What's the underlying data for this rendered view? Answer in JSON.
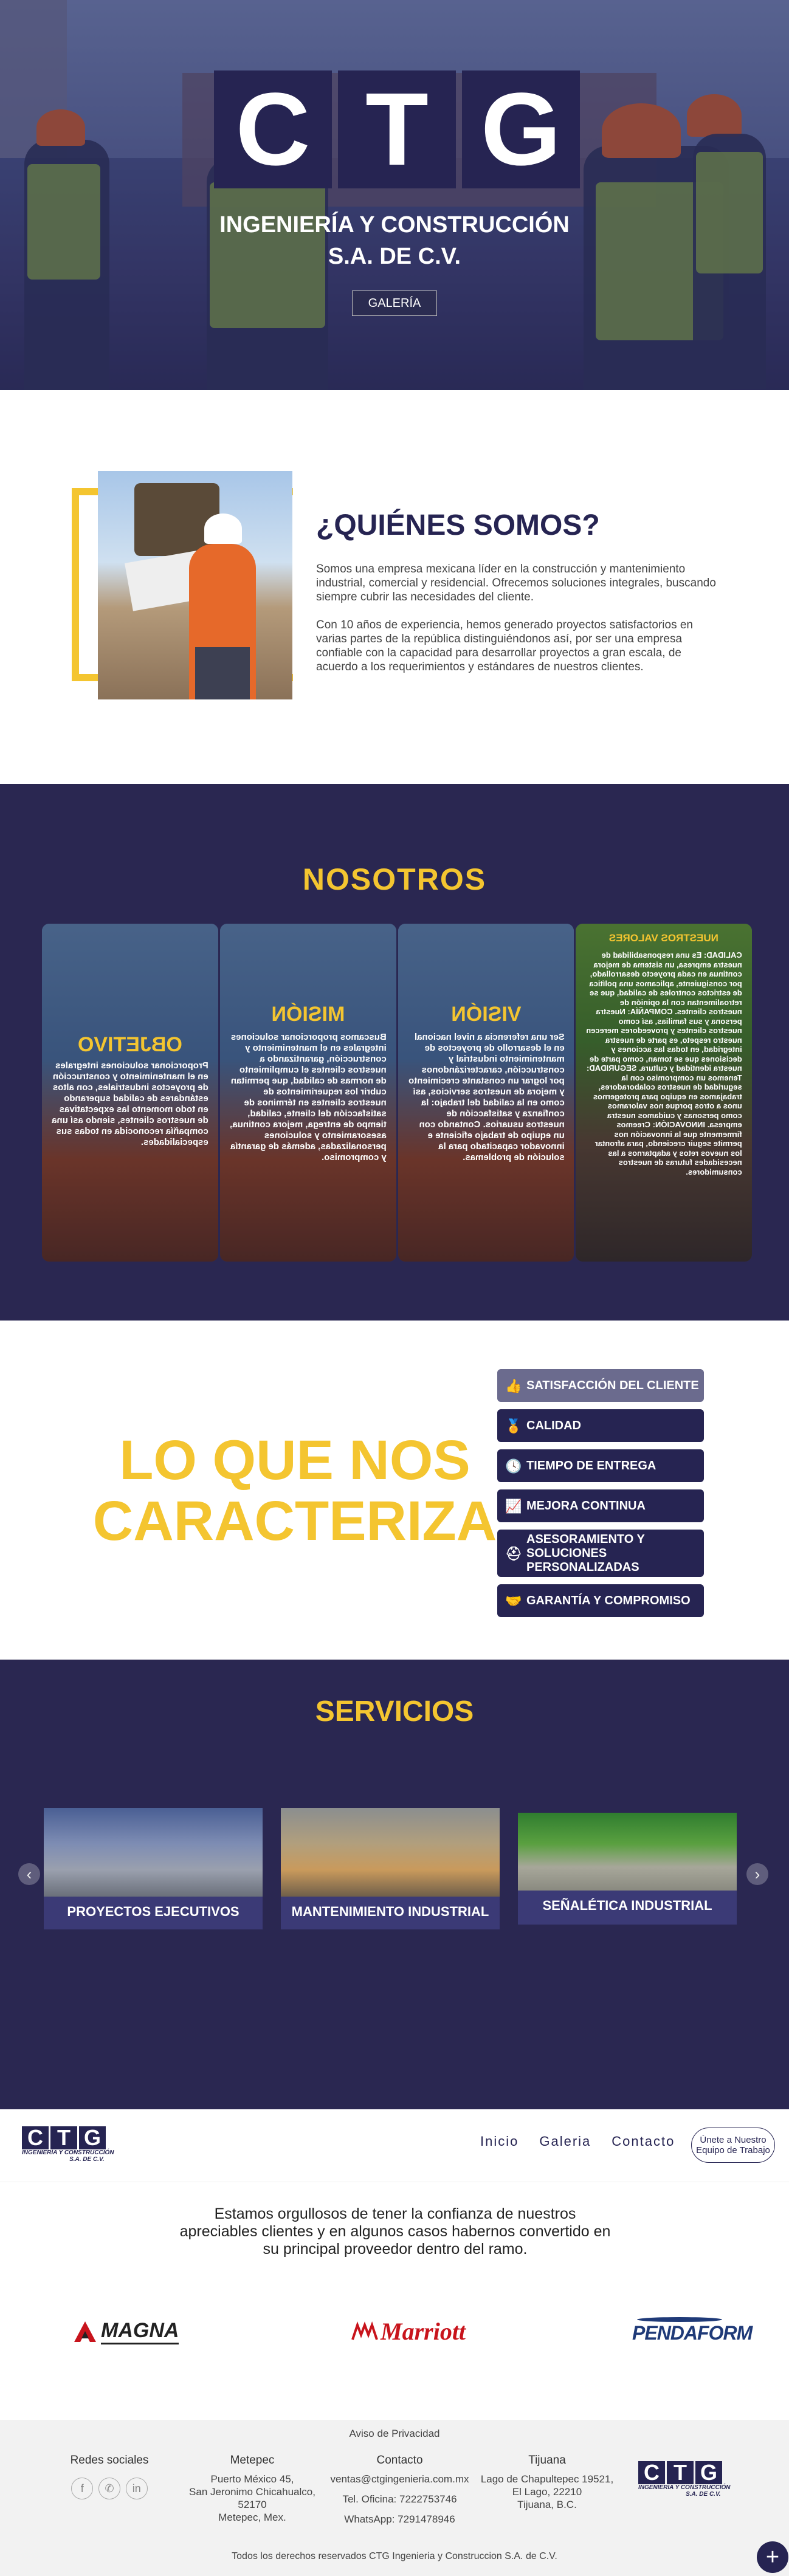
{
  "hero": {
    "logo_letters": [
      "C",
      "T",
      "G"
    ],
    "subtitle_line1": "INGENIERÍA Y CONSTRUCCIÓN",
    "subtitle_line2": "S.A. DE C.V.",
    "gallery_button": "GALERÍA"
  },
  "about": {
    "title": "¿QUIÉNES SOMOS?",
    "paragraph1": "Somos una empresa mexicana líder en la construcción y mantenimiento industrial, comercial y residencial. Ofrecemos soluciones integrales, buscando siempre cubrir las necesidades del cliente.",
    "paragraph2": "Con 10 años de experiencia, hemos generado proyectos satisfactorios en varias partes de la república distinguiéndonos así, por ser una empresa confiable con la capacidad para desarrollar proyectos a gran escala, de acuerdo a los requerimientos y estándares de nuestros clientes."
  },
  "nosotros": {
    "title": "NOSOTROS",
    "cards": [
      {
        "heading": "OBJETIVO",
        "text": "Proporcionar soluciones integrales en el mantenimiento y construcción de proyectos industriales, con altos estándares de calidad superando en todo momento las expectativas de nuestros clientes, siendo así una compañía reconocida en todas sus especialidades."
      },
      {
        "heading": "MISIÓN",
        "text": "Buscamos proporcionar soluciones integrales en el mantenimiento y construcción, garantizando a nuestros clientes el cumplimiento de normas de calidad, que permitan cubrir los requerimientos de nuestros clientes en términos de satisfacción del cliente, calidad, tiempo de entrega, mejora continua, asesoramiento y soluciones personalizadas, además de garantía y compromiso."
      },
      {
        "heading": "VISIÓN",
        "text": "Ser una referencia a nivel nacional en el desarrollo de proyectos de mantenimiento industrial y construcción, caracterizándonos por lograr un constante crecimiento y mejora de nuestros servicios, así como en la calidad del trabajo: la confianza y satisfacción de nuestros usuarios. Contando con un equipo de trabajo eficiente e innovador capacitado para la solución de problemas."
      },
      {
        "heading": "NUESTROS VALORES",
        "text": "CALIDAD: Es una responsabilidad de nuestra empresa, un sistema de mejora continua en cada proyecto desarrollado, por consiguiente, aplicamos una política de estrictos controles de calidad, que se retroalimentan con la opinión de nuestros clientes. COMPAÑÍA: Nuestra persona y sus familias, así como nuestros clientes y proveedores merecen nuestro respeto, es parte de nuestra integridad, en todas las acciones y decisiones que se toman, como parte de nuestra identidad y cultura. SEGURIDAD: Tenemos un compromiso con la seguridad de nuestros colaboradores, trabajamos en equipo para protegernos unos a otros porque nos valoramos como personas y cuidamos nuestra empresa. INNOVACIÓN: Creemos firmemente que la innovación nos permite seguir creciendo, para afrontar los nuevos retos y adaptarnos a las necesidades futuras de nuestros consumidores."
      }
    ]
  },
  "features": {
    "title_line1": "LO QUE NOS",
    "title_line2": "CARACTERIZA",
    "items": [
      {
        "label": "SATISFACCIÓN DEL CLIENTE",
        "icon": "thumbs-up-icon",
        "glyph": "👍"
      },
      {
        "label": "CALIDAD",
        "icon": "medal-icon",
        "glyph": "🏅"
      },
      {
        "label": "TIEMPO DE ENTREGA",
        "icon": "clock-icon",
        "glyph": "🕓"
      },
      {
        "label": "MEJORA CONTINUA",
        "icon": "chart-line-icon",
        "glyph": "📈"
      },
      {
        "label": "ASESORAMIENTO Y SOLUCIONES PERSONALIZADAS",
        "icon": "helmet-icon",
        "glyph": "⛑"
      },
      {
        "label": "GARANTÍA Y COMPROMISO",
        "icon": "handshake-icon",
        "glyph": "🤝"
      }
    ]
  },
  "services": {
    "title": "SERVICIOS",
    "items": [
      {
        "label": "PROYECTOS EJECUTIVOS"
      },
      {
        "label": "MANTENIMIENTO INDUSTRIAL"
      },
      {
        "label": "SEÑALÉTICA INDUSTRIAL"
      }
    ],
    "prev_glyph": "‹",
    "next_glyph": "›"
  },
  "navbar": {
    "logo_letters": [
      "C",
      "T",
      "G"
    ],
    "logo_sub1": "INGENIERÍA Y CONSTRUCCIÓN",
    "logo_sub2": "S.A. DE C.V.",
    "links": [
      "Inicio",
      "Galeria",
      "Contacto"
    ],
    "cta": "Únete a Nuestro Equipo de Trabajo"
  },
  "clients": {
    "text": "Estamos orgullosos de tener la confianza de nuestros apreciables clientes y en algunos casos habernos convertido en su principal proveedor dentro del ramo.",
    "logos": [
      "MAGNA",
      "Marriott",
      "PENDAFORM"
    ]
  },
  "footer": {
    "privacy": "Aviso de Privacidad",
    "social_heading": "Redes sociales",
    "social": [
      {
        "name": "facebook-icon",
        "glyph": "f"
      },
      {
        "name": "whatsapp-icon",
        "glyph": "✆"
      },
      {
        "name": "linkedin-icon",
        "glyph": "in"
      }
    ],
    "metepec_heading": "Metepec",
    "metepec_addr1": "Puerto México 45,",
    "metepec_addr2": "San Jeronimo Chicahualco,",
    "metepec_addr3": "52170",
    "metepec_addr4": "Metepec, Mex.",
    "contact_heading": "Contacto",
    "contact_email": "ventas@ctgingenieria.com.mx",
    "contact_phone": "Tel. Oficina: 7222753746",
    "contact_whatsapp": "WhatsApp: 7291478946",
    "tijuana_heading": "Tijuana",
    "tijuana_addr1": "Lago de Chapultepec 19521,",
    "tijuana_addr2": "El Lago, 22210",
    "tijuana_addr3": "Tijuana, B.C.",
    "copyright": "Todos los derechos reservados CTG Ingenieria y Construccion S.A. de C.V.",
    "plus": "+"
  },
  "colors": {
    "navy": "#262452",
    "section_bg": "#2a2751",
    "accent_yellow": "#f4c530"
  }
}
